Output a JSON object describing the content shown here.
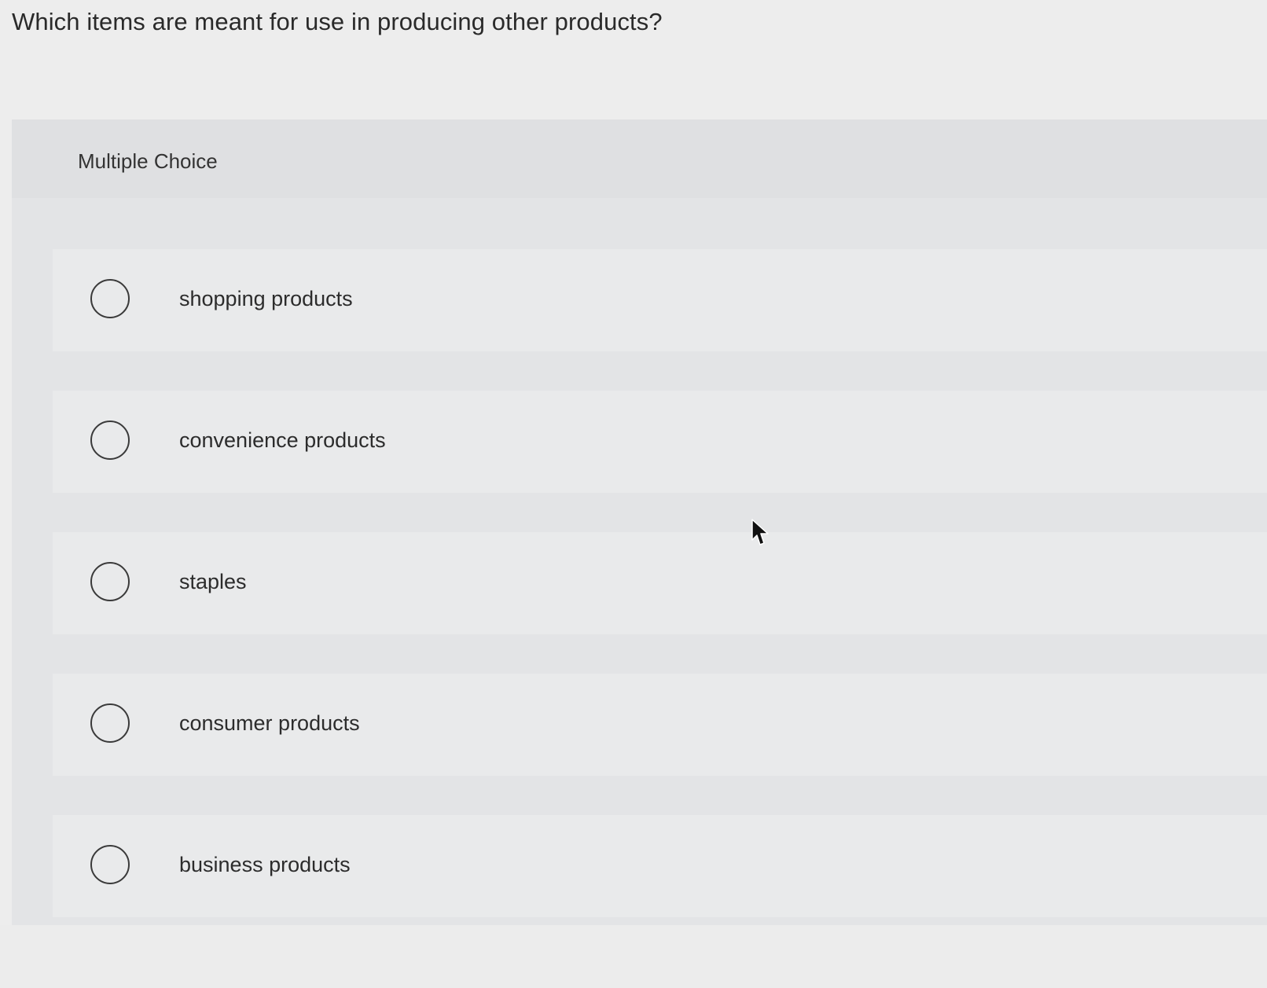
{
  "question": {
    "text": "Which items are meant for use in producing other products?"
  },
  "panel": {
    "header_label": "Multiple Choice"
  },
  "choices": [
    {
      "label": "shopping products",
      "selected": false
    },
    {
      "label": "convenience products",
      "selected": false
    },
    {
      "label": "staples",
      "selected": false
    },
    {
      "label": "consumer products",
      "selected": false
    },
    {
      "label": "business products",
      "selected": false
    }
  ],
  "icons": {
    "radio": "radio-unselected-icon",
    "cursor": "mouse-pointer-icon"
  }
}
